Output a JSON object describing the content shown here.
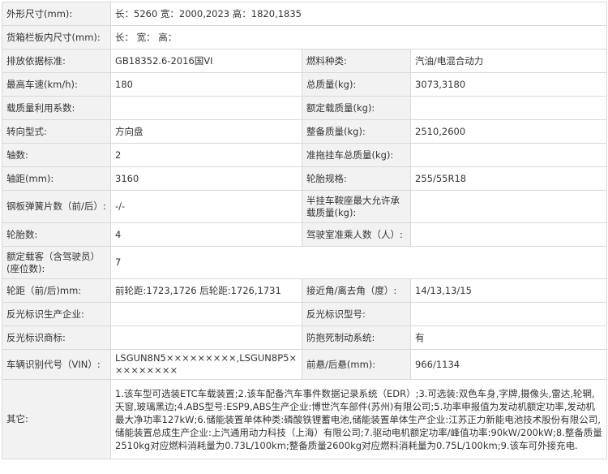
{
  "rows": [
    {
      "label": "外形尺寸(mm):",
      "value": "长：5260 宽：2000,2023 高：1820,1835"
    },
    {
      "label": "货箱栏板内尺寸(mm):",
      "value": "长： 宽： 高："
    },
    {
      "l1": "排放依据标准:",
      "v1": "GB18352.6-2016国VI",
      "l2": "燃料种类:",
      "v2": "汽油/电混合动力"
    },
    {
      "l1": "最高车速(km/h):",
      "v1": "180",
      "l2": "总质量(kg):",
      "v2": "3073,3180"
    },
    {
      "l1": "载质量利用系数:",
      "v1": "",
      "l2": "额定载质量(kg):",
      "v2": ""
    },
    {
      "l1": "转向型式:",
      "v1": "方向盘",
      "l2": "整备质量(kg):",
      "v2": "2510,2600"
    },
    {
      "l1": "轴数:",
      "v1": "2",
      "l2": "准拖挂车总质量(kg):",
      "v2": ""
    },
    {
      "l1": "轴距(mm):",
      "v1": "3160",
      "l2": "轮胎规格:",
      "v2": "255/55R18"
    },
    {
      "l1": "钢板弹簧片数（前/后）:",
      "v1": "-/-",
      "l2": "半挂车鞍座最大允许承载质量(kg):",
      "v2": ""
    },
    {
      "l1": "轮胎数:",
      "v1": "4",
      "l2": "驾驶室准乘人数（人）:",
      "v2": ""
    },
    {
      "l1": "额定载客（含驾驶员）(座位数):",
      "v1": "7",
      "l2": "",
      "v2": ""
    },
    {
      "l1": "轮距（前/后)mm:",
      "v1": "前轮距:1723,1726 后轮距:1726,1731",
      "l2": "接近角/离去角（度）:",
      "v2": "14/13,13/15"
    },
    {
      "l1": "反光标识生产企业:",
      "v1": "",
      "l2": "反光标识型号:",
      "v2": ""
    },
    {
      "l1": "反光标识商标:",
      "v1": "",
      "l2": "防抱死制动系统:",
      "v2": "有"
    },
    {
      "l1": "车辆识别代号（VIN）:",
      "v1": "LSGUN8N5×××××××××,LSGUN8P5×××××××××",
      "l2": "前悬/后悬(mm):",
      "v2": "966/1134"
    }
  ],
  "other": {
    "label": "其它:",
    "value": "1.该车型可选装ETC车载装置;2.该车配备汽车事件数据记录系统（EDR）;3.可选装:双色车身,字牌,摄像头,雷达,轮辋,天窗,玻璃黑边;4.ABS型号:ESP9,ABS生产企业:博世汽车部件(苏州)有限公司;5.功率申报值为发动机额定功率,发动机最大净功率127kW;6.储能装置单体种类:磷酸铁锂蓄电池,储能装置单体生产企业:江苏正力新能电池技术股份有限公司,储能装置总成生产企业:上汽通用动力科技（上海）有限公司;7.驱动电机额定功率/峰值功率:90kW/200kW;8.整备质量2510kg对应燃料消耗量为0.73L/100km;整备质量2600kg对应燃料消耗量为0.75L/100km;9.该车可外接充电."
  }
}
